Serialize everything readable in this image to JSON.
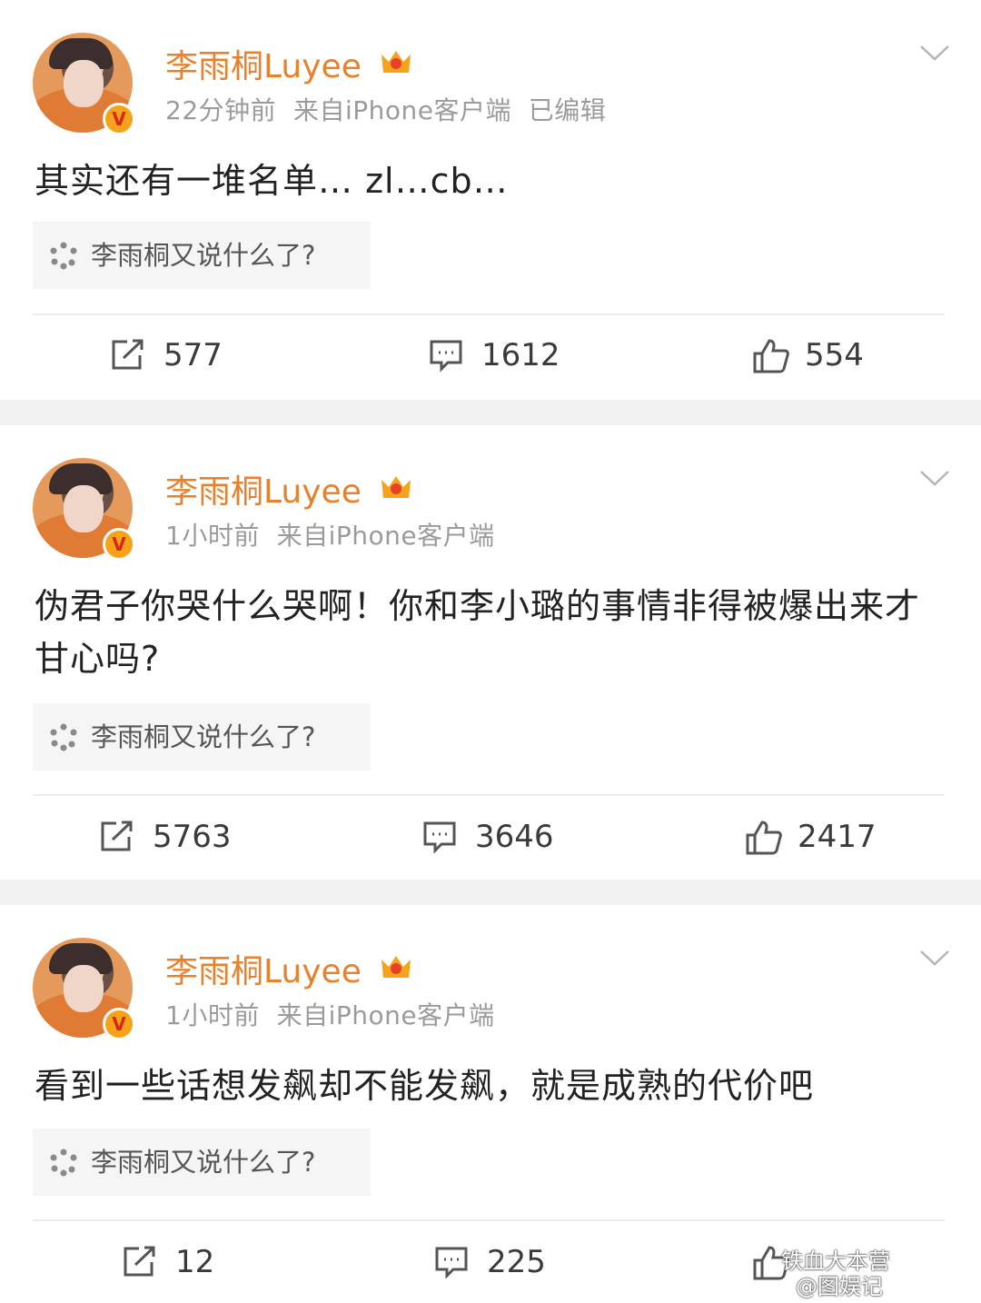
{
  "posts": [
    {
      "author": "李雨桐Luyee",
      "time": "22分钟前",
      "source": "来自iPhone客户端",
      "edited": "已编辑",
      "content": "其实还有一堆名单… zl…cb…",
      "topic": "李雨桐又说什么了?",
      "reposts": "577",
      "comments": "1612",
      "likes": "554"
    },
    {
      "author": "李雨桐Luyee",
      "time": "1小时前",
      "source": "来自iPhone客户端",
      "edited": "",
      "content": "伪君子你哭什么哭啊！你和李小璐的事情非得被爆出来才甘心吗?",
      "topic": "李雨桐又说什么了?",
      "reposts": "5763",
      "comments": "3646",
      "likes": "2417"
    },
    {
      "author": "李雨桐Luyee",
      "time": "1小时前",
      "source": "来自iPhone客户端",
      "edited": "",
      "content": "看到一些话想发飙却不能发飙，就是成熟的代价吧",
      "topic": "李雨桐又说什么了?",
      "reposts": "12",
      "comments": "225",
      "likes": ""
    }
  ],
  "verified_badge": "V",
  "watermark": {
    "line1": "铁血大本营",
    "line2": "@图娱记"
  },
  "colors": {
    "author": "#e8812d",
    "meta": "#9b9b9b",
    "separator": "#f2f2f2"
  },
  "icons": [
    "more-chevron-icon",
    "crown-icon",
    "verified-badge-icon",
    "topic-spark-icon",
    "repost-icon",
    "comment-icon",
    "like-icon"
  ]
}
